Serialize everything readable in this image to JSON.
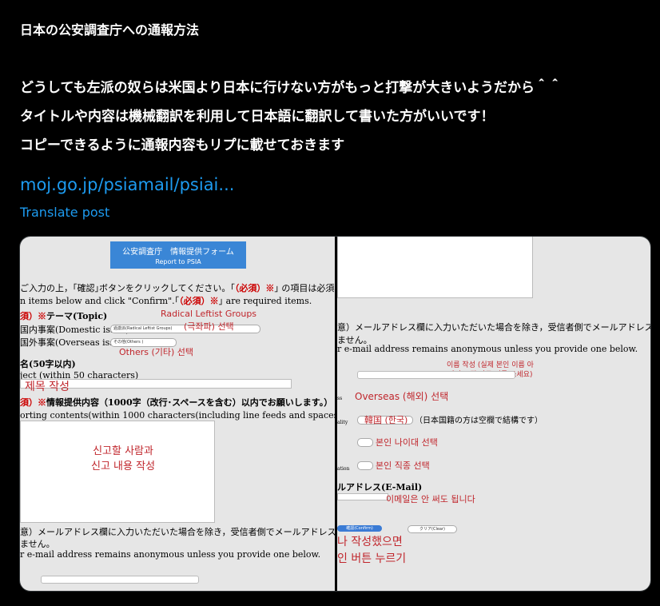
{
  "post": {
    "title": "日本の公安調査庁への通報方法",
    "lines": [
      "どうしても左派の奴らは米国より日本に行けない方がもっと打撃が大きいようだから＾＾",
      "タイトルや内容は機械翻訳を利用して日本語に翻訳して書いた方がいいです！",
      "コピーできるように通報内容もリプに載せておきます"
    ],
    "link": "moj.go.jp/psiamail/psiai...",
    "translate": "Translate post"
  },
  "left_panel": {
    "header_title": "公安調査庁　情報提供フォーム",
    "header_sub": "Report to PSIA",
    "instr_jp_a": "ご入力の上，｢確認｣ボタンをクリックしてください。｢",
    "instr_jp_req": "（必須）※",
    "instr_jp_b": "｣ の項目は必須項目で",
    "instr_en_a": "n items below and click \"Confirm\".｢",
    "instr_en_req": "（必須）※",
    "instr_en_b": "｣ are required items.",
    "theme_req": "須）※",
    "theme_label": "テーマ(Topic)",
    "domestic_label": "国内事案(Domestic issue)",
    "domestic_select": "過激派(Radical Leftist Groups)",
    "overseas_label": "国外事案(Overseas issue)",
    "overseas_select": "その他(Others )",
    "title_label": "名(50字以内)",
    "title_en": "ject (within 50 characters)",
    "contents_req": "須）※",
    "contents_label": "情報提供内容（1000字（改行･スペースを含む）以内でお願いします。）",
    "contents_en": "orting contents(within 1000 characters(including line feeds and spaces).)",
    "email_jp": "意）メールアドレス欄に入力いただいた場合を除き，受信者側でメールアドレスは取得し",
    "email_jp2": "ません。",
    "email_en": "r e-mail address remains anonymous unless you provide one below.",
    "ann_radical": "Radical Leftist Groups",
    "ann_radical_ko": "(극좌파) 선택",
    "ann_others": "Others (기타) 선택",
    "ann_title": "제목 작성",
    "ann_content_1": "신고할 사람과",
    "ann_content_2": "신고 내용 작성"
  },
  "right_panel": {
    "email_jp": "意）メールアドレス欄に入力いただいた場合を除き，受信者側でメールアドレスは取得し",
    "email_jp2": "ません。",
    "email_en": "r e-mail address remains anonymous unless you provide one below.",
    "label_ss": "ss",
    "label_ality": "ality",
    "label_ation": "ation",
    "nationality_note": "（日本国籍の方は空欄で結構です）",
    "email_label": "ルアドレス(E-Mail)",
    "confirm_label": "確認(Confirm)",
    "clear_label": "クリア(Clear)",
    "ann_name_1": "이름 작성 (실제 본인 이름 아",
    "ann_name_2": "니어도 됨 아무 이름 쓰세요)",
    "ann_overseas": "Overseas (해외) 선택",
    "ann_korea": "韓国 (한국)",
    "ann_age": "본인 나이대 선택",
    "ann_job": "본인 직종 선택",
    "ann_email": "이메일은 안 써도 됩니다",
    "ann_done_1": "나 작성했으면",
    "ann_done_2": "인 버튼 누르기"
  }
}
